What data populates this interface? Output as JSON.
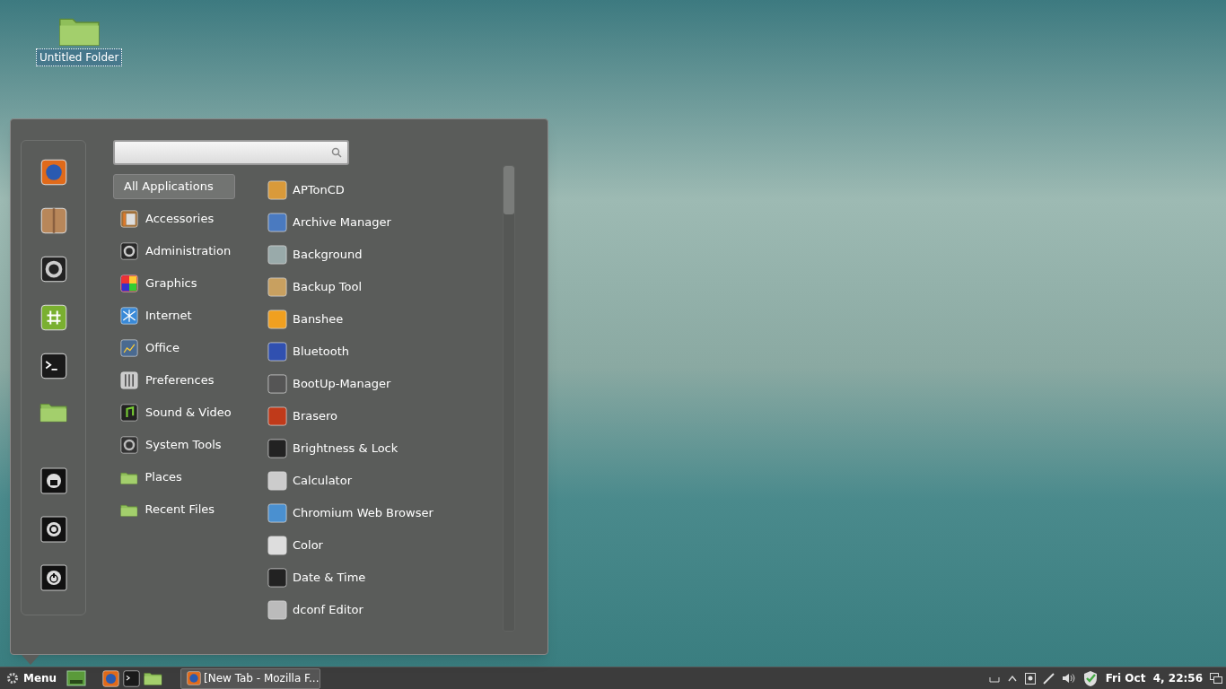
{
  "desktop": {
    "icons": [
      {
        "label": "Untitled Folder",
        "selected": true
      }
    ]
  },
  "menu": {
    "categories": [
      {
        "label": "All Applications",
        "selected": true
      },
      {
        "label": "Accessories",
        "selected": false
      },
      {
        "label": "Administration",
        "selected": false
      },
      {
        "label": "Graphics",
        "selected": false
      },
      {
        "label": "Internet",
        "selected": false
      },
      {
        "label": "Office",
        "selected": false
      },
      {
        "label": "Preferences",
        "selected": false
      },
      {
        "label": "Sound & Video",
        "selected": false
      },
      {
        "label": "System Tools",
        "selected": false
      },
      {
        "label": "Places",
        "selected": false
      },
      {
        "label": "Recent Files",
        "selected": false
      }
    ],
    "applications": [
      "APTonCD",
      "Archive Manager",
      "Background",
      "Backup Tool",
      "Banshee",
      "Bluetooth",
      "BootUp-Manager",
      "Brasero",
      "Brightness & Lock",
      "Calculator",
      "Chromium Web Browser",
      "Color",
      "Date & Time",
      "dconf Editor"
    ]
  },
  "taskbar": {
    "menu_button": "Menu",
    "window_buttons": [
      {
        "label": "[New Tab - Mozilla F..."
      }
    ],
    "clock": "Fri Oct  4, 22:56"
  }
}
